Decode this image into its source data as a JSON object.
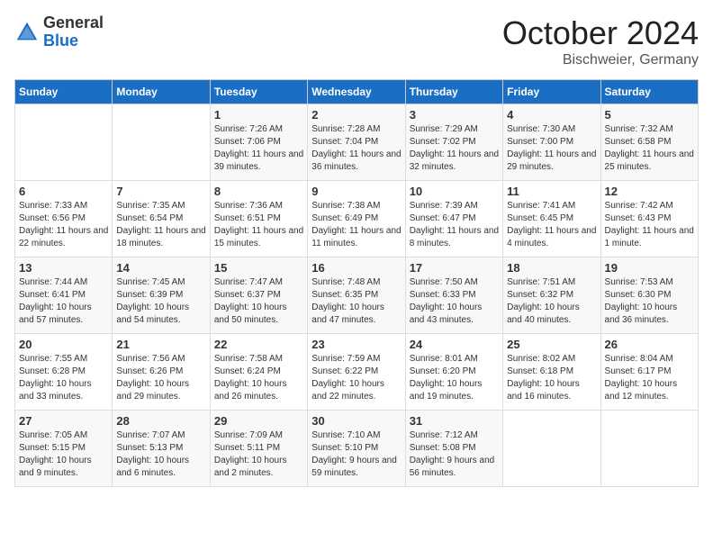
{
  "header": {
    "logo_general": "General",
    "logo_blue": "Blue",
    "title": "October 2024",
    "subtitle": "Bischweier, Germany"
  },
  "days_of_week": [
    "Sunday",
    "Monday",
    "Tuesday",
    "Wednesday",
    "Thursday",
    "Friday",
    "Saturday"
  ],
  "weeks": [
    [
      {
        "day": "",
        "info": ""
      },
      {
        "day": "",
        "info": ""
      },
      {
        "day": "1",
        "info": "Sunrise: 7:26 AM\nSunset: 7:06 PM\nDaylight: 11 hours and 39 minutes."
      },
      {
        "day": "2",
        "info": "Sunrise: 7:28 AM\nSunset: 7:04 PM\nDaylight: 11 hours and 36 minutes."
      },
      {
        "day": "3",
        "info": "Sunrise: 7:29 AM\nSunset: 7:02 PM\nDaylight: 11 hours and 32 minutes."
      },
      {
        "day": "4",
        "info": "Sunrise: 7:30 AM\nSunset: 7:00 PM\nDaylight: 11 hours and 29 minutes."
      },
      {
        "day": "5",
        "info": "Sunrise: 7:32 AM\nSunset: 6:58 PM\nDaylight: 11 hours and 25 minutes."
      }
    ],
    [
      {
        "day": "6",
        "info": "Sunrise: 7:33 AM\nSunset: 6:56 PM\nDaylight: 11 hours and 22 minutes."
      },
      {
        "day": "7",
        "info": "Sunrise: 7:35 AM\nSunset: 6:54 PM\nDaylight: 11 hours and 18 minutes."
      },
      {
        "day": "8",
        "info": "Sunrise: 7:36 AM\nSunset: 6:51 PM\nDaylight: 11 hours and 15 minutes."
      },
      {
        "day": "9",
        "info": "Sunrise: 7:38 AM\nSunset: 6:49 PM\nDaylight: 11 hours and 11 minutes."
      },
      {
        "day": "10",
        "info": "Sunrise: 7:39 AM\nSunset: 6:47 PM\nDaylight: 11 hours and 8 minutes."
      },
      {
        "day": "11",
        "info": "Sunrise: 7:41 AM\nSunset: 6:45 PM\nDaylight: 11 hours and 4 minutes."
      },
      {
        "day": "12",
        "info": "Sunrise: 7:42 AM\nSunset: 6:43 PM\nDaylight: 11 hours and 1 minute."
      }
    ],
    [
      {
        "day": "13",
        "info": "Sunrise: 7:44 AM\nSunset: 6:41 PM\nDaylight: 10 hours and 57 minutes."
      },
      {
        "day": "14",
        "info": "Sunrise: 7:45 AM\nSunset: 6:39 PM\nDaylight: 10 hours and 54 minutes."
      },
      {
        "day": "15",
        "info": "Sunrise: 7:47 AM\nSunset: 6:37 PM\nDaylight: 10 hours and 50 minutes."
      },
      {
        "day": "16",
        "info": "Sunrise: 7:48 AM\nSunset: 6:35 PM\nDaylight: 10 hours and 47 minutes."
      },
      {
        "day": "17",
        "info": "Sunrise: 7:50 AM\nSunset: 6:33 PM\nDaylight: 10 hours and 43 minutes."
      },
      {
        "day": "18",
        "info": "Sunrise: 7:51 AM\nSunset: 6:32 PM\nDaylight: 10 hours and 40 minutes."
      },
      {
        "day": "19",
        "info": "Sunrise: 7:53 AM\nSunset: 6:30 PM\nDaylight: 10 hours and 36 minutes."
      }
    ],
    [
      {
        "day": "20",
        "info": "Sunrise: 7:55 AM\nSunset: 6:28 PM\nDaylight: 10 hours and 33 minutes."
      },
      {
        "day": "21",
        "info": "Sunrise: 7:56 AM\nSunset: 6:26 PM\nDaylight: 10 hours and 29 minutes."
      },
      {
        "day": "22",
        "info": "Sunrise: 7:58 AM\nSunset: 6:24 PM\nDaylight: 10 hours and 26 minutes."
      },
      {
        "day": "23",
        "info": "Sunrise: 7:59 AM\nSunset: 6:22 PM\nDaylight: 10 hours and 22 minutes."
      },
      {
        "day": "24",
        "info": "Sunrise: 8:01 AM\nSunset: 6:20 PM\nDaylight: 10 hours and 19 minutes."
      },
      {
        "day": "25",
        "info": "Sunrise: 8:02 AM\nSunset: 6:18 PM\nDaylight: 10 hours and 16 minutes."
      },
      {
        "day": "26",
        "info": "Sunrise: 8:04 AM\nSunset: 6:17 PM\nDaylight: 10 hours and 12 minutes."
      }
    ],
    [
      {
        "day": "27",
        "info": "Sunrise: 7:05 AM\nSunset: 5:15 PM\nDaylight: 10 hours and 9 minutes."
      },
      {
        "day": "28",
        "info": "Sunrise: 7:07 AM\nSunset: 5:13 PM\nDaylight: 10 hours and 6 minutes."
      },
      {
        "day": "29",
        "info": "Sunrise: 7:09 AM\nSunset: 5:11 PM\nDaylight: 10 hours and 2 minutes."
      },
      {
        "day": "30",
        "info": "Sunrise: 7:10 AM\nSunset: 5:10 PM\nDaylight: 9 hours and 59 minutes."
      },
      {
        "day": "31",
        "info": "Sunrise: 7:12 AM\nSunset: 5:08 PM\nDaylight: 9 hours and 56 minutes."
      },
      {
        "day": "",
        "info": ""
      },
      {
        "day": "",
        "info": ""
      }
    ]
  ]
}
